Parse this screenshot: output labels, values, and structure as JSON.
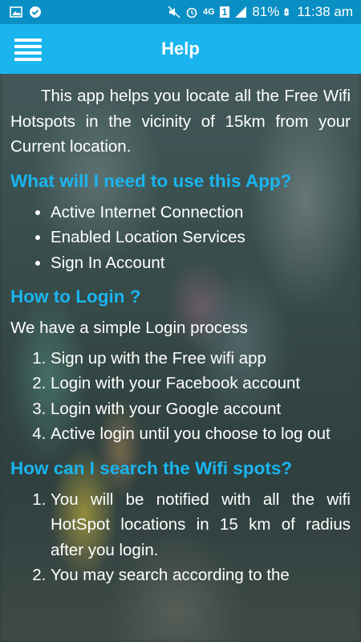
{
  "status_bar": {
    "network": "4G",
    "sim": "1",
    "battery": "81%",
    "time": "11:38 am"
  },
  "app_bar": {
    "title": "Help",
    "menu_icon": "hamburger-menu-icon"
  },
  "content": {
    "intro": "This app helps you locate all the Free Wifi Hotspots in the vicinity of 15km from your Current location.",
    "sections": [
      {
        "heading": "What will I need to use this App?",
        "items": [
          "Active Internet Connection",
          "Enabled Location Services",
          "Sign In Account"
        ]
      },
      {
        "heading": "How to Login ?",
        "text": "We have a simple Login process",
        "items": [
          "Sign up with the Free wifi app",
          "Login with your Facebook account",
          "Login with your Google account",
          "Active login until you choose to log out"
        ]
      },
      {
        "heading": "How can I search the Wifi spots?",
        "items": [
          "You will be notified with all the wifi HotSpot locations in 15 km of radius after you login.",
          "You may search according to the"
        ]
      }
    ]
  },
  "colors": {
    "status_bar": "#0a8fc4",
    "app_bar": "#1ab5ef",
    "heading": "#1ab5ef",
    "text": "#ffffff"
  }
}
